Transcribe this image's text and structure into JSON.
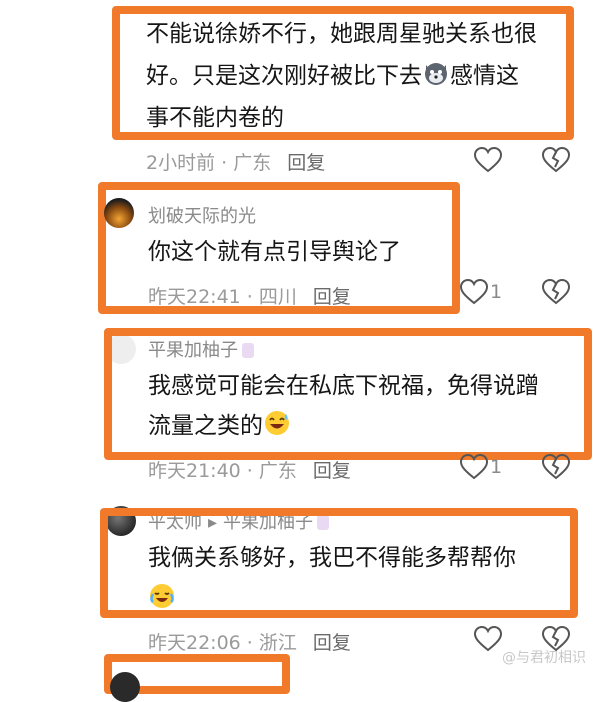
{
  "comments": [
    {
      "lines": [
        "不能说徐娇不行，她跟周星驰关系也很",
        "好。只是这次刚好被比下去",
        "感情这",
        "事不能内卷的"
      ],
      "meta": "2小时前 · 广东",
      "reply": "回复"
    },
    {
      "user": "划破天际的光",
      "text": "你这个就有点引导舆论了",
      "meta": "昨天22:41 · 四川",
      "reply": "回复",
      "likes": "1"
    },
    {
      "user": "平果加柚子",
      "lines": [
        "我感觉可能会在私底下祝福，免得说蹭",
        "流量之类的"
      ],
      "meta": "昨天21:40 · 广东",
      "reply": "回复",
      "likes": "1"
    },
    {
      "user": "平太帅",
      "reply_to": "平果加柚子",
      "lines": [
        "我俩关系够好，我巴不得能多帮帮你"
      ],
      "meta": "昨天22:06 · 浙江",
      "reply": "回复"
    }
  ],
  "watermark": "@与君初相识",
  "icons": [
    "heart-icon",
    "heart-broken-icon",
    "wolf-emoji-icon",
    "laugh-sweat-emoji-icon",
    "cry-laugh-emoji-icon"
  ],
  "colors": {
    "highlight": "#f07a2a",
    "text": "#161616",
    "meta": "#9a9a9a"
  }
}
